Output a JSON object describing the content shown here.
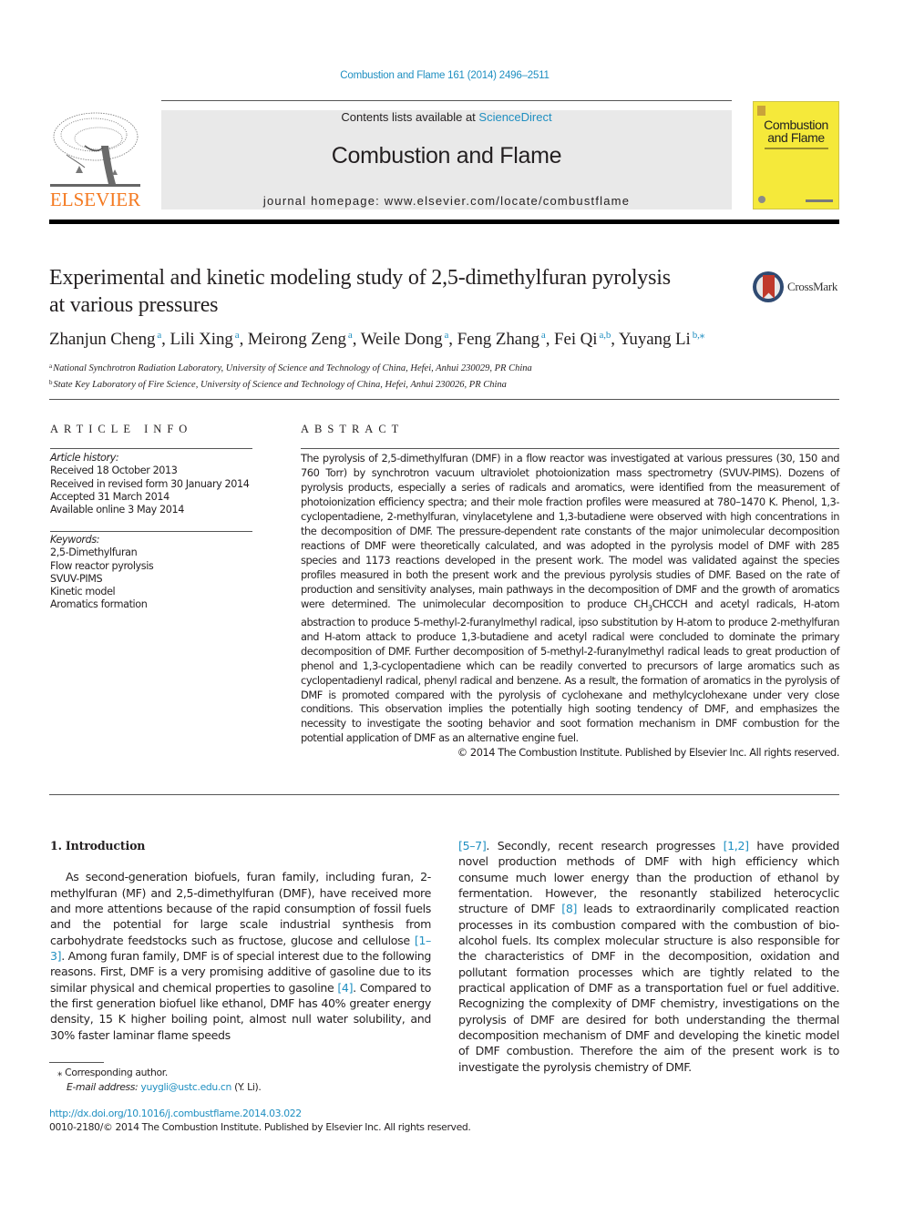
{
  "header": {
    "journal_reference": "Combustion and Flame 161 (2014) 2496–2511",
    "publisher_logo_text": "ELSEVIER",
    "contents_prefix": "Contents lists available at ",
    "contents_link": "ScienceDirect",
    "journal_name": "Combustion and Flame",
    "homepage_prefix": "journal homepage: ",
    "homepage_url": "www.elsevier.com/locate/combustflame",
    "cover_title_line1": "Combustion",
    "cover_title_line2": "and Flame",
    "crossmark_label": "CrossMark",
    "colors": {
      "link": "#1f8fc1",
      "elsevier_orange": "#f47920",
      "masthead_bg": "#e9e9e9",
      "cover_yellow": "#f5e93a"
    }
  },
  "article": {
    "title_line1": "Experimental and kinetic modeling study of 2,5-dimethylfuran pyrolysis",
    "title_line2": "at various pressures",
    "authors": [
      {
        "name": "Zhanjun Cheng",
        "sup": "a",
        "sep": ", "
      },
      {
        "name": "Lili Xing",
        "sup": "a",
        "sep": ", "
      },
      {
        "name": "Meirong Zeng",
        "sup": "a",
        "sep": ", "
      },
      {
        "name": "Weile Dong",
        "sup": "a",
        "sep": ", "
      },
      {
        "name": "Feng Zhang",
        "sup": "a",
        "sep": ", "
      },
      {
        "name": "Fei Qi",
        "sup": "a,b",
        "sep": ", "
      },
      {
        "name": "Yuyang Li",
        "sup": "b,⁎",
        "sep": ""
      }
    ],
    "affiliations": [
      {
        "mark": "a",
        "text": "National Synchrotron Radiation Laboratory, University of Science and Technology of China, Hefei, Anhui 230029, PR China"
      },
      {
        "mark": "b",
        "text": "State Key Laboratory of Fire Science, University of Science and Technology of China, Hefei, Anhui 230026, PR China"
      }
    ]
  },
  "article_info": {
    "heading": "ARTICLE INFO",
    "history_label": "Article history:",
    "history": [
      "Received 18 October 2013",
      "Received in revised form 30 January 2014",
      "Accepted 31 March 2014",
      "Available online 3 May 2014"
    ],
    "keywords_label": "Keywords:",
    "keywords": [
      "2,5-Dimethylfuran",
      "Flow reactor pyrolysis",
      "SVUV-PIMS",
      "Kinetic model",
      "Aromatics formation"
    ]
  },
  "abstract": {
    "heading": "ABSTRACT",
    "text_part1": "The pyrolysis of 2,5-dimethylfuran (DMF) in a flow reactor was investigated at various pressures (30, 150 and 760 Torr) by synchrotron vacuum ultraviolet photoionization mass spectrometry (SVUV-PIMS). Dozens of pyrolysis products, especially a series of radicals and aromatics, were identified from the measurement of photoionization efficiency spectra; and their mole fraction profiles were measured at 780–1470 K. Phenol, 1,3-cyclopentadiene, 2-methylfuran, vinylacetylene and 1,3-butadiene were observed with high concentrations in the decomposition of DMF. The pressure-dependent rate constants of the major unimolecular decomposition reactions of DMF were theoretically calculated, and was adopted in the pyrolysis model of DMF with 285 species and 1173 reactions developed in the present work. The model was validated against the species profiles measured in both the present work and the previous pyrolysis studies of DMF. Based on the rate of production and sensitivity analyses, main pathways in the decomposition of DMF and the growth of aromatics were determined. The unimolecular decomposition to produce CH",
    "subscript": "3",
    "text_part2": "CHCCH and acetyl radicals, H-atom abstraction to produce 5-methyl-2-furanylmethyl radical, ipso substitution by H-atom to produce 2-methylfuran and H-atom attack to produce 1,3-butadiene and acetyl radical were concluded to dominate the primary decomposition of DMF. Further decomposition of 5-methyl-2-furanylmethyl radical leads to great production of phenol and 1,3-cyclopentadiene which can be readily converted to precursors of large aromatics such as cyclopentadienyl radical, phenyl radical and benzene. As a result, the formation of aromatics in the pyrolysis of DMF is promoted compared with the pyrolysis of cyclohexane and methylcyclohexane under very close conditions. This observation implies the potentially high sooting tendency of DMF, and emphasizes the necessity to investigate the sooting behavior and soot formation mechanism in DMF combustion for the potential application of DMF as an alternative engine fuel.",
    "copyright": "© 2014 The Combustion Institute. Published by Elsevier Inc. All rights reserved."
  },
  "body": {
    "section_heading": "1. Introduction",
    "left": {
      "p1_a": "As second-generation biofuels, furan family, including furan, 2-methylfuran (MF) and 2,5-dimethylfuran (DMF), have received more and more attentions because of the rapid consumption of fossil fuels and the potential for large scale industrial synthesis from carbohydrate feedstocks such as fructose, glucose and cellulose ",
      "cite1": "[1–3]",
      "p1_b": ". Among furan family, DMF is of special interest due to the following reasons. First, DMF is a very promising additive of gasoline due to its similar physical and chemical properties to gasoline ",
      "cite2": "[4]",
      "p1_c": ". Compared to the first generation biofuel like ethanol, DMF has 40% greater energy density, 15 K higher boiling point, almost null water solubility, and 30% faster laminar flame speeds"
    },
    "right": {
      "cite3": "[5–7]",
      "p_a": ". Secondly, recent research progresses ",
      "cite4": "[1,2]",
      "p_b": " have provided novel production methods of DMF with high efficiency which consume much lower energy than the production of ethanol by fermentation. However, the resonantly stabilized heterocyclic structure of DMF ",
      "cite5": "[8]",
      "p_c": " leads to extraordinarily complicated reaction processes in its combustion compared with the combustion of bio-alcohol fuels. Its complex molecular structure is also responsible for the characteristics of DMF in the decomposition, oxidation and pollutant formation processes which are tightly related to the practical application of DMF as a transportation fuel or fuel additive. Recognizing the complexity of DMF chemistry, investigations on the pyrolysis of DMF are desired for both understanding the thermal decomposition mechanism of DMF and developing the kinetic model of DMF combustion. Therefore the aim of the present work is to investigate the pyrolysis chemistry of DMF."
    }
  },
  "footnotes": {
    "corresponding_mark": "⁎",
    "corresponding_text": "Corresponding author.",
    "email_label": "E-mail address: ",
    "email": "yuygli@ustc.edu.cn",
    "email_suffix": " (Y. Li).",
    "doi": "http://dx.doi.org/10.1016/j.combustflame.2014.03.022",
    "issn_line": "0010-2180/© 2014 The Combustion Institute. Published by Elsevier Inc. All rights reserved."
  }
}
